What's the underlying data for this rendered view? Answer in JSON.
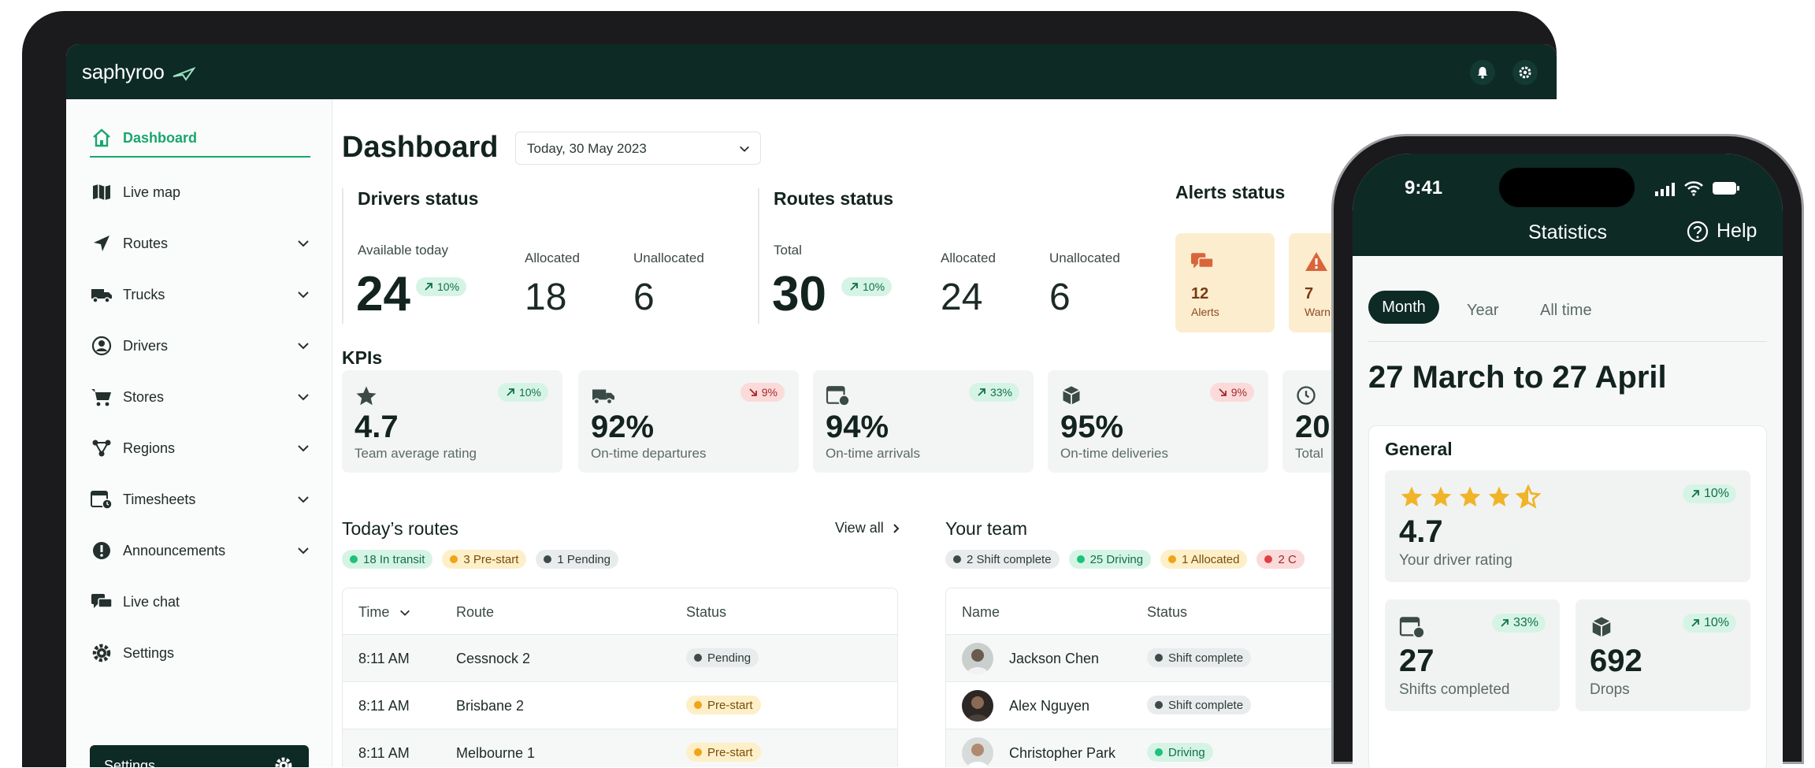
{
  "app": {
    "logo": "saphyroo"
  },
  "sidebar": {
    "items": [
      {
        "label": "Dashboard"
      },
      {
        "label": "Live map"
      },
      {
        "label": "Routes"
      },
      {
        "label": "Trucks"
      },
      {
        "label": "Drivers"
      },
      {
        "label": "Stores"
      },
      {
        "label": "Regions"
      },
      {
        "label": "Timesheets"
      },
      {
        "label": "Announcements"
      },
      {
        "label": "Live chat"
      },
      {
        "label": "Settings"
      }
    ],
    "bottom_settings": "Settings"
  },
  "main": {
    "title": "Dashboard",
    "date_select": "Today, 30 May 2023",
    "drivers": {
      "title": "Drivers status",
      "available_label": "Available today",
      "available_value": "24",
      "available_change": "10%",
      "allocated_label": "Allocated",
      "allocated_value": "18",
      "unallocated_label": "Unallocated",
      "unallocated_value": "6"
    },
    "routes": {
      "title": "Routes status",
      "total_label": "Total",
      "total_value": "30",
      "total_change": "10%",
      "allocated_label": "Allocated",
      "allocated_value": "24",
      "unallocated_label": "Unallocated",
      "unallocated_value": "6"
    },
    "alerts": {
      "title": "Alerts status",
      "cards": [
        {
          "value": "12",
          "label": "Alerts"
        },
        {
          "value": "7",
          "label": "Warn"
        }
      ]
    },
    "kpis": {
      "title": "KPIs",
      "cards": [
        {
          "value": "4.7",
          "label": "Team average rating",
          "change": "10%",
          "direction": "up"
        },
        {
          "value": "92%",
          "label": "On-time departures",
          "change": "9%",
          "direction": "down"
        },
        {
          "value": "94%",
          "label": "On-time arrivals",
          "change": "33%",
          "direction": "up"
        },
        {
          "value": "95%",
          "label": "On-time deliveries",
          "change": "9%",
          "direction": "down"
        },
        {
          "value": "20",
          "label": "Total"
        }
      ]
    },
    "todays_routes": {
      "title": "Today’s routes",
      "view_all": "View all",
      "chips": [
        "18 In transit",
        "3 Pre-start",
        "1 Pending"
      ],
      "columns": [
        "Time",
        "Route",
        "Status"
      ],
      "rows": [
        {
          "time": "8:11 AM",
          "route": "Cessnock 2",
          "status": "Pending"
        },
        {
          "time": "8:11 AM",
          "route": "Brisbane 2",
          "status": "Pre-start"
        },
        {
          "time": "8:11 AM",
          "route": "Melbourne 1",
          "status": "Pre-start"
        }
      ]
    },
    "team": {
      "title": "Your team",
      "chips": [
        "2 Shift complete",
        "25 Driving",
        "1 Allocated",
        "2 C"
      ],
      "columns": [
        "Name",
        "Status"
      ],
      "rows": [
        {
          "name": "Jackson Chen",
          "status": "Shift complete"
        },
        {
          "name": "Alex Nguyen",
          "status": "Shift complete"
        },
        {
          "name": "Christopher Park",
          "status": "Driving"
        }
      ]
    }
  },
  "phone": {
    "time": "9:41",
    "title": "Statistics",
    "help": "Help",
    "tabs": [
      "Month",
      "Year",
      "All time"
    ],
    "range": "27 March to 27 April",
    "general_title": "General",
    "rating": {
      "value": "4.7",
      "label": "Your driver rating",
      "change": "10%",
      "stars": 4.5
    },
    "shifts": {
      "value": "27",
      "label": "Shifts completed",
      "change": "33%"
    },
    "drops": {
      "value": "692",
      "label": "Drops",
      "change": "10%"
    }
  },
  "colors": {
    "brand_dark": "#0d2a24",
    "accent_green": "#1aa66e",
    "star": "#f0b429"
  }
}
